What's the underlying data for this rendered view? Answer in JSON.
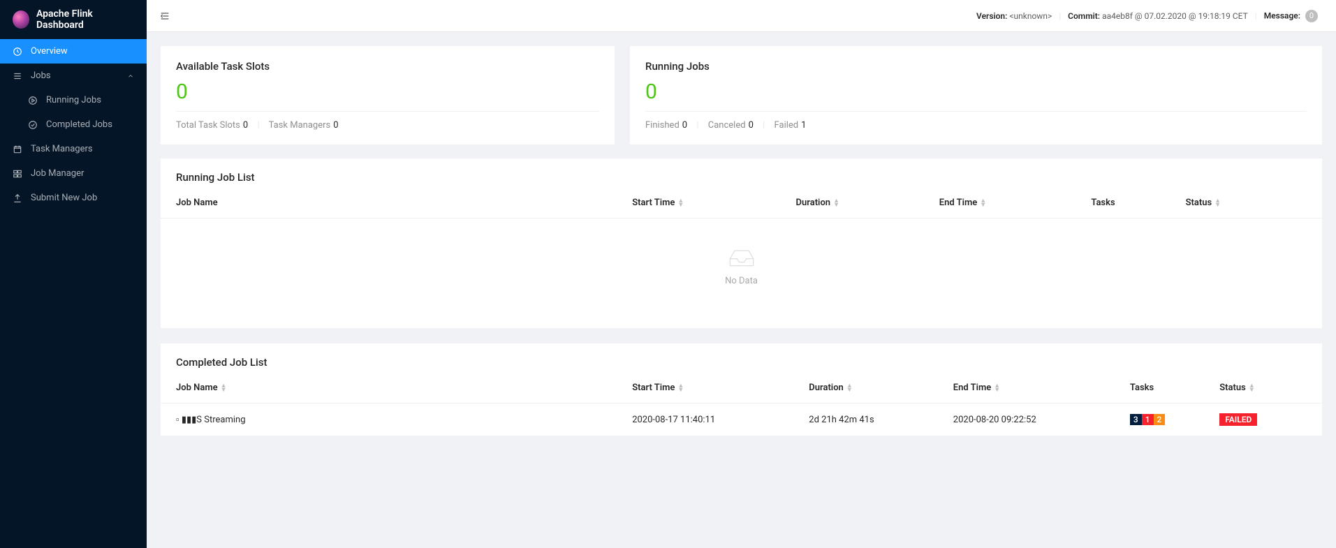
{
  "brand": "Apache Flink Dashboard",
  "sidebar": {
    "overview": "Overview",
    "jobs": "Jobs",
    "running_jobs": "Running Jobs",
    "completed_jobs": "Completed Jobs",
    "task_managers": "Task Managers",
    "job_manager": "Job Manager",
    "submit_new_job": "Submit New Job"
  },
  "header": {
    "version_label": "Version:",
    "version_value": "<unknown>",
    "commit_label": "Commit:",
    "commit_value": "aa4eb8f @ 07.02.2020 @ 19:18:19 CET",
    "message_label": "Message:",
    "message_count": "0"
  },
  "slots_card": {
    "title": "Available Task Slots",
    "value": "0",
    "total_label": "Total Task Slots",
    "total_value": "0",
    "tm_label": "Task Managers",
    "tm_value": "0"
  },
  "jobs_card": {
    "title": "Running Jobs",
    "value": "0",
    "finished_label": "Finished",
    "finished_value": "0",
    "canceled_label": "Canceled",
    "canceled_value": "0",
    "failed_label": "Failed",
    "failed_value": "1"
  },
  "running_panel": {
    "title": "Running Job List",
    "empty": "No Data"
  },
  "completed_panel": {
    "title": "Completed Job List"
  },
  "columns": {
    "job_name": "Job Name",
    "start_time": "Start Time",
    "duration": "Duration",
    "end_time": "End Time",
    "tasks": "Tasks",
    "status": "Status"
  },
  "completed_rows": [
    {
      "name": "▫ ▮▮▮S Streaming",
      "start": "2020-08-17 11:40:11",
      "duration": "2d 21h 42m 41s",
      "end": "2020-08-20 09:22:52",
      "tasks": [
        "3",
        "1",
        "2"
      ],
      "status": "FAILED"
    }
  ]
}
